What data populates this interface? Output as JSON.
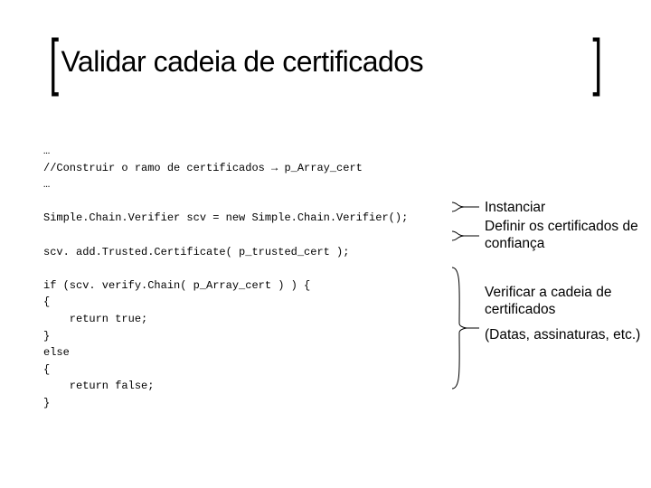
{
  "title": "Validar cadeia de certificados",
  "code": {
    "l1": "…",
    "l2": "//Construir o ramo de certificados → p_Array_cert",
    "l3": "…",
    "l4": "",
    "l5": "Simple.Chain.Verifier scv = new Simple.Chain.Verifier();",
    "l6": "",
    "l7": "scv. add.Trusted.Certificate( p_trusted_cert );",
    "l8": "",
    "l9": "if (scv. verify.Chain( p_Array_cert ) ) {",
    "l10": "{",
    "l11": "    return true;",
    "l12": "}",
    "l13": "else",
    "l14": "{",
    "l15": "    return false;",
    "l16": "}"
  },
  "annots": {
    "a1": "Instanciar",
    "a2": "Definir os certificados de confiança",
    "a3": "Verificar a cadeia de certificados",
    "a4": "(Datas, assinaturas, etc.)"
  }
}
